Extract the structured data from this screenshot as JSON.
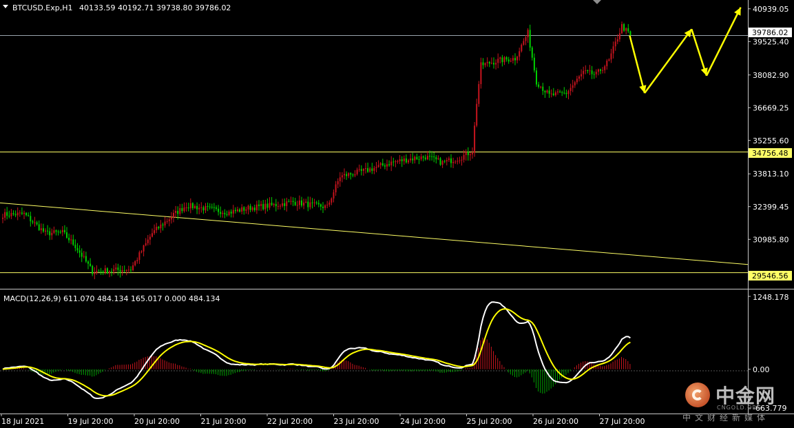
{
  "header": {
    "symbol": "BTCUSD.Exp,H1",
    "ohlc": "40133.59 40192.71 39738.80 39786.02"
  },
  "macd_header": "MACD(12,26,9) 611.070 484.134 165.017 0.000 484.134",
  "price_axis": {
    "ticks": [
      "40939.05",
      "39525.40",
      "38082.90",
      "36669.25",
      "35255.60",
      "33813.10",
      "32399.45",
      "30985.80"
    ],
    "tick_values": [
      40939.05,
      39525.4,
      38082.9,
      36669.25,
      35255.6,
      33813.1,
      32399.45,
      30985.8
    ],
    "current_label": "39786.02",
    "level_high_label": "34756.48",
    "level_low_label": "29546.56"
  },
  "macd_axis": {
    "ticks": [
      "1248.178",
      "0.00",
      "-663.779"
    ],
    "tick_values": [
      1248.178,
      0,
      -663.779
    ]
  },
  "time_axis": [
    "18 Jul 2021",
    "19 Jul 20:00",
    "20 Jul 20:00",
    "21 Jul 20:00",
    "22 Jul 20:00",
    "23 Jul 20:00",
    "24 Jul 20:00",
    "25 Jul 20:00",
    "26 Jul 20:00",
    "27 Jul 20:00"
  ],
  "watermark": {
    "name": "中金网",
    "domain": "CNGOLD.ORG",
    "sub": "中文财经新媒体"
  },
  "colors": {
    "bull": "#c8141e",
    "bear": "#00d000",
    "level": "#ffff66",
    "forecast": "#ffff00",
    "macd_line": "#ffffff",
    "signal_line": "#ffff00",
    "hist_pos": "#c8141e",
    "hist_neg": "#00a000",
    "grid_current": "#9aa3ad"
  },
  "chart_data": [
    {
      "type": "candlestick",
      "timeframe": "H1",
      "ylim": [
        29000,
        41200
      ],
      "y_scale": "linear",
      "current_price": 39786.02,
      "horizontal_levels": [
        34756.48,
        29546.56
      ],
      "trendline": {
        "from": 32560,
        "to": 29900
      },
      "close_path": [
        {
          "h": 0,
          "v": 32050
        },
        {
          "h": 10,
          "v": 32080
        },
        {
          "h": 20,
          "v": 31250
        },
        {
          "h": 28,
          "v": 31280
        },
        {
          "h": 34,
          "v": 30700
        },
        {
          "h": 42,
          "v": 29600
        },
        {
          "h": 52,
          "v": 29650
        },
        {
          "h": 60,
          "v": 29700
        },
        {
          "h": 70,
          "v": 31250
        },
        {
          "h": 80,
          "v": 32050
        },
        {
          "h": 86,
          "v": 32450
        },
        {
          "h": 96,
          "v": 32300
        },
        {
          "h": 106,
          "v": 32150
        },
        {
          "h": 116,
          "v": 32350
        },
        {
          "h": 126,
          "v": 32450
        },
        {
          "h": 136,
          "v": 32600
        },
        {
          "h": 146,
          "v": 32450
        },
        {
          "h": 152,
          "v": 32380
        },
        {
          "h": 158,
          "v": 33700
        },
        {
          "h": 170,
          "v": 33950
        },
        {
          "h": 182,
          "v": 34300
        },
        {
          "h": 190,
          "v": 34450
        },
        {
          "h": 198,
          "v": 34550
        },
        {
          "h": 206,
          "v": 34300
        },
        {
          "h": 214,
          "v": 34500
        },
        {
          "h": 220,
          "v": 34800
        },
        {
          "h": 222,
          "v": 36900
        },
        {
          "h": 224,
          "v": 38500
        },
        {
          "h": 232,
          "v": 38700
        },
        {
          "h": 240,
          "v": 38800
        },
        {
          "h": 246,
          "v": 39900
        },
        {
          "h": 250,
          "v": 37800
        },
        {
          "h": 256,
          "v": 37200
        },
        {
          "h": 264,
          "v": 37300
        },
        {
          "h": 272,
          "v": 38200
        },
        {
          "h": 278,
          "v": 38100
        },
        {
          "h": 284,
          "v": 38700
        },
        {
          "h": 290,
          "v": 40200
        },
        {
          "h": 294,
          "v": 39786
        }
      ],
      "forecast_path": [
        {
          "h": 294,
          "v": 39786
        },
        {
          "h": 301,
          "v": 37300
        },
        {
          "h": 323,
          "v": 40060
        },
        {
          "h": 330,
          "v": 38050
        },
        {
          "h": 346,
          "v": 41000
        }
      ],
      "seed": 7
    },
    {
      "type": "macd",
      "params": "12,26,9",
      "values": {
        "macd": 611.07,
        "signal": 484.134,
        "histogram": 165.017
      },
      "ylim": [
        -663.779,
        1248.178
      ]
    }
  ]
}
